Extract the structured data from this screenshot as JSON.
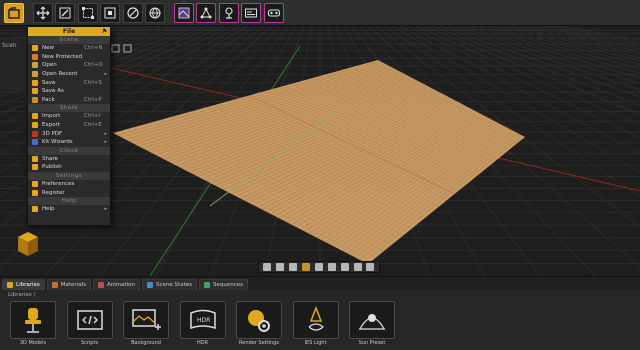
{
  "toolbar": {
    "buttons": [
      {
        "name": "file-icon",
        "active": true
      },
      {
        "name": "move-icon"
      },
      {
        "name": "pen-icon"
      },
      {
        "name": "select-box-icon"
      },
      {
        "name": "pixel-icon"
      },
      {
        "name": "brush-icon"
      },
      {
        "name": "globe-icon"
      },
      {
        "name": "texture-icon"
      },
      {
        "name": "network-icon"
      },
      {
        "name": "lamp-icon"
      },
      {
        "name": "timeline-icon"
      },
      {
        "name": "vr-headset-icon"
      }
    ]
  },
  "scene_panel": {
    "label": "Scen"
  },
  "file_menu": {
    "title": "File",
    "sections": [
      {
        "label": "Scene",
        "items": [
          {
            "label": "New",
            "shortcut": "Ctrl+N",
            "icon": "#e0a820"
          },
          {
            "label": "New Protected",
            "shortcut": "",
            "icon": "#d08020"
          },
          {
            "label": "Open",
            "shortcut": "Ctrl+O",
            "icon": "#d0a040"
          },
          {
            "label": "Open Recent",
            "shortcut": "",
            "icon": "#d0a040",
            "submenu": true
          },
          {
            "label": "Save",
            "shortcut": "Ctrl+S",
            "icon": "#e0a820"
          },
          {
            "label": "Save As",
            "shortcut": "",
            "icon": "#e0a820"
          },
          {
            "label": "Pack",
            "shortcut": "Ctrl+P",
            "icon": "#c8902a"
          }
        ]
      },
      {
        "label": "Share",
        "items": [
          {
            "label": "Import",
            "shortcut": "Ctrl+I",
            "icon": "#e0a820"
          },
          {
            "label": "Export",
            "shortcut": "Ctrl+E",
            "icon": "#e0a820"
          },
          {
            "label": "3D PDF",
            "shortcut": "",
            "icon": "#c03030",
            "submenu": true
          },
          {
            "label": "Kit Wizards",
            "shortcut": "",
            "icon": "#4070c0",
            "submenu": true
          }
        ]
      },
      {
        "label": "Cloud",
        "items": [
          {
            "label": "Share",
            "shortcut": "",
            "icon": "#e0a820"
          },
          {
            "label": "Publish",
            "shortcut": "",
            "icon": "#e0a820"
          }
        ]
      },
      {
        "label": "Settings",
        "items": [
          {
            "label": "Preferences",
            "shortcut": "",
            "icon": "#e0a820"
          },
          {
            "label": "Register",
            "shortcut": "",
            "icon": "#e0a820"
          }
        ]
      },
      {
        "label": "Help",
        "items": [
          {
            "label": "Help",
            "shortcut": "",
            "icon": "#e0a820",
            "submenu": true
          }
        ]
      }
    ]
  },
  "tabs": [
    {
      "label": "Libraries",
      "active": true,
      "icon": "#e0a820"
    },
    {
      "label": "Materials",
      "icon": "#c07030"
    },
    {
      "label": "Animation",
      "icon": "#c05050"
    },
    {
      "label": "Scene States",
      "icon": "#4090c0"
    },
    {
      "label": "Sequences",
      "icon": "#40a060"
    }
  ],
  "breadcrumb": "Libraries  /",
  "library": [
    {
      "label": "3D Models",
      "icon": "chair-icon"
    },
    {
      "label": "Scripts",
      "icon": "code-icon"
    },
    {
      "label": "Background",
      "icon": "background-image-icon"
    },
    {
      "label": "HDR",
      "icon": "hdr-panorama-icon"
    },
    {
      "label": "Render Settings",
      "icon": "render-settings-icon"
    },
    {
      "label": "IES Light",
      "icon": "ies-light-icon"
    },
    {
      "label": "Sun Preset",
      "icon": "sun-preset-icon"
    }
  ],
  "colors": {
    "accent": "#e0a820",
    "floor": "#c89a64",
    "grid": "#3a3a3a"
  }
}
